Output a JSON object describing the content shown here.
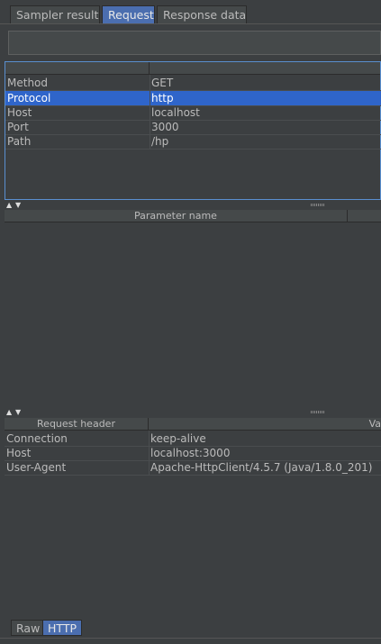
{
  "tabs": [
    {
      "label": "Sampler result"
    },
    {
      "label": "Request"
    },
    {
      "label": "Response data"
    }
  ],
  "request_table": {
    "headers": [
      "",
      ""
    ],
    "rows": [
      {
        "name": "Method",
        "value": "GET"
      },
      {
        "name": "Protocol",
        "value": "http"
      },
      {
        "name": "Host",
        "value": "localhost"
      },
      {
        "name": "Port",
        "value": "3000"
      },
      {
        "name": "Path",
        "value": "/hp"
      }
    ]
  },
  "params_table": {
    "headers": [
      "Parameter name",
      ""
    ]
  },
  "headers_table": {
    "headers": [
      "Request header",
      "Va"
    ],
    "rows": [
      {
        "name": "Connection",
        "value": "keep-alive"
      },
      {
        "name": "Host",
        "value": "localhost:3000"
      },
      {
        "name": "User-Agent",
        "value": "Apache-HttpClient/4.5.7 (Java/1.8.0_201)"
      }
    ]
  },
  "bottom_tabs": [
    {
      "label": "Raw"
    },
    {
      "label": "HTTP"
    }
  ],
  "colors": {
    "background": "#3c3f41",
    "selection": "#2f65ca",
    "tab_selected": "#4b6eaf"
  }
}
